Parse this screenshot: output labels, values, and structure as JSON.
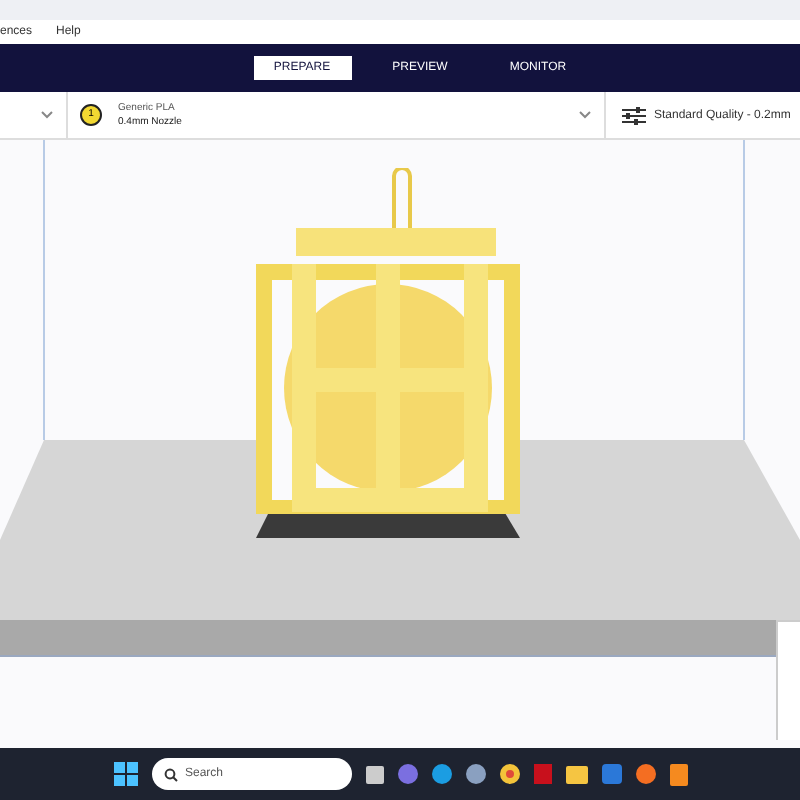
{
  "menu": [
    {
      "label": "ences"
    },
    {
      "label": "Help"
    }
  ],
  "tabs": [
    {
      "label": "PREPARE",
      "selected": true
    },
    {
      "label": "PREVIEW",
      "selected": false
    },
    {
      "label": "MONITOR",
      "selected": false
    }
  ],
  "printer_bar": {
    "extruder_number": "1",
    "material": "Generic PLA",
    "nozzle": "0.4mm Nozzle",
    "quality": "Standard Quality - 0.2mm"
  },
  "taskbar": {
    "search_placeholder": "Search"
  }
}
